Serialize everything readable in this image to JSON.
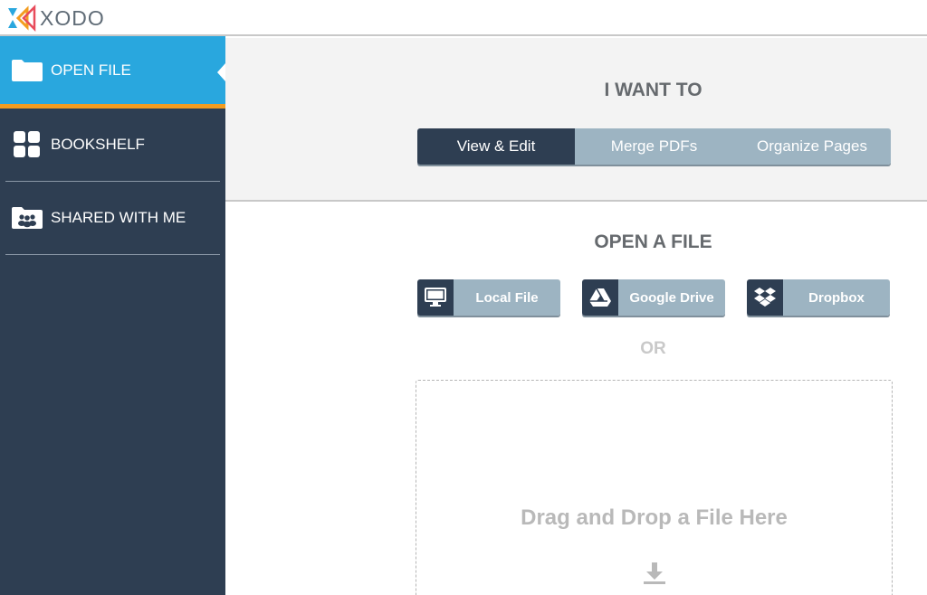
{
  "app": {
    "logo_text": "XODO"
  },
  "sidebar": {
    "items": [
      {
        "label": "OPEN FILE",
        "icon": "folder-icon",
        "active": true
      },
      {
        "label": "BOOKSHELF",
        "icon": "grid-icon",
        "active": false
      },
      {
        "label": "SHARED WITH ME",
        "icon": "shared-folder-icon",
        "active": false
      }
    ]
  },
  "want": {
    "title": "I WANT TO",
    "options": [
      "View & Edit",
      "Merge PDFs",
      "Organize Pages"
    ],
    "selected": "View & Edit"
  },
  "open": {
    "title": "OPEN A FILE",
    "sources": [
      {
        "label": "Local File",
        "icon": "monitor-icon"
      },
      {
        "label": "Google Drive",
        "icon": "google-drive-icon"
      },
      {
        "label": "Dropbox",
        "icon": "dropbox-icon"
      }
    ],
    "or_text": "OR",
    "drop_text": "Drag and Drop a File Here",
    "drop_icon": "download-icon"
  },
  "colors": {
    "sidebar_bg": "#2e3e52",
    "active_blue": "#29a7de",
    "active_underline": "#f39c1f",
    "button_light": "#9db4c2"
  }
}
